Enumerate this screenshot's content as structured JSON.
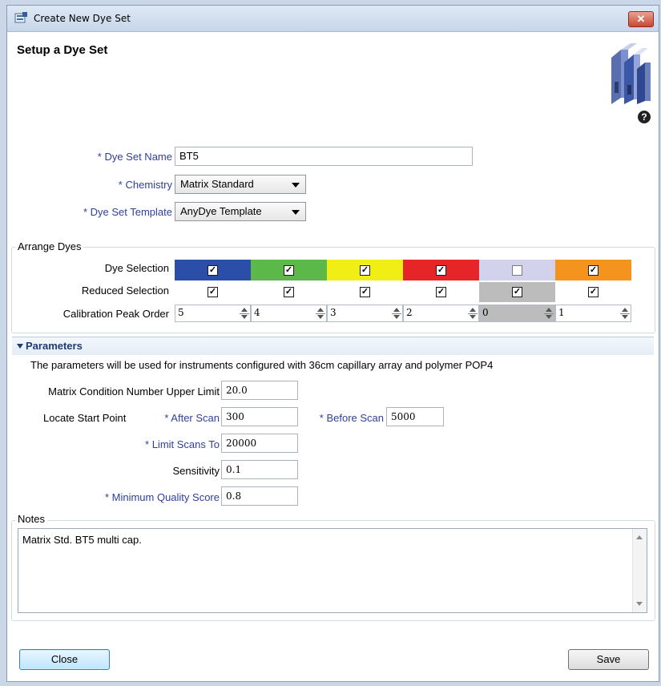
{
  "window": {
    "title": "Create New Dye Set",
    "close_symbol": "✕"
  },
  "heading": "Setup a Dye Set",
  "help_symbol": "?",
  "form": {
    "dye_set_name": {
      "label": "Dye Set Name",
      "value": "BT5"
    },
    "chemistry": {
      "label": "Chemistry",
      "value": "Matrix Standard"
    },
    "template": {
      "label": "Dye Set Template",
      "value": "AnyDye Template"
    },
    "required_mark": "*"
  },
  "arrange": {
    "title": "Arrange Dyes",
    "row_labels": {
      "dye": "Dye Selection",
      "reduced": "Reduced Selection",
      "order": "Calibration Peak Order"
    },
    "dyes": [
      {
        "color": "#2b4ea8",
        "dye_checked": true,
        "reduced_checked": true,
        "order": "5",
        "disabled": false
      },
      {
        "color": "#5cb848",
        "dye_checked": true,
        "reduced_checked": true,
        "order": "4",
        "disabled": false
      },
      {
        "color": "#f1ee16",
        "dye_checked": true,
        "reduced_checked": true,
        "order": "3",
        "disabled": false
      },
      {
        "color": "#e52528",
        "dye_checked": true,
        "reduced_checked": true,
        "order": "2",
        "disabled": false
      },
      {
        "color": "#d2d2ec",
        "dye_checked": false,
        "reduced_checked": true,
        "order": "0",
        "disabled": true
      },
      {
        "color": "#f4931e",
        "dye_checked": true,
        "reduced_checked": true,
        "order": "1",
        "disabled": false
      }
    ]
  },
  "parameters": {
    "title": "Parameters",
    "description": "The parameters will be used for instruments configured with 36cm capillary array and polymer POP4",
    "matrix_label": "Matrix Condition Number Upper Limit",
    "matrix_value": "20.0",
    "locate_label": "Locate Start Point",
    "after_scan_label": "After Scan",
    "after_scan_value": "300",
    "before_scan_label": "Before Scan",
    "before_scan_value": "5000",
    "limit_label": "Limit Scans To",
    "limit_value": "20000",
    "sensitivity_label": "Sensitivity",
    "sensitivity_value": "0.1",
    "min_quality_label": "Minimum Quality Score",
    "min_quality_value": "0.8"
  },
  "notes": {
    "title": "Notes",
    "text": "Matrix Std. BT5 multi cap."
  },
  "buttons": {
    "close": "Close",
    "save": "Save"
  }
}
